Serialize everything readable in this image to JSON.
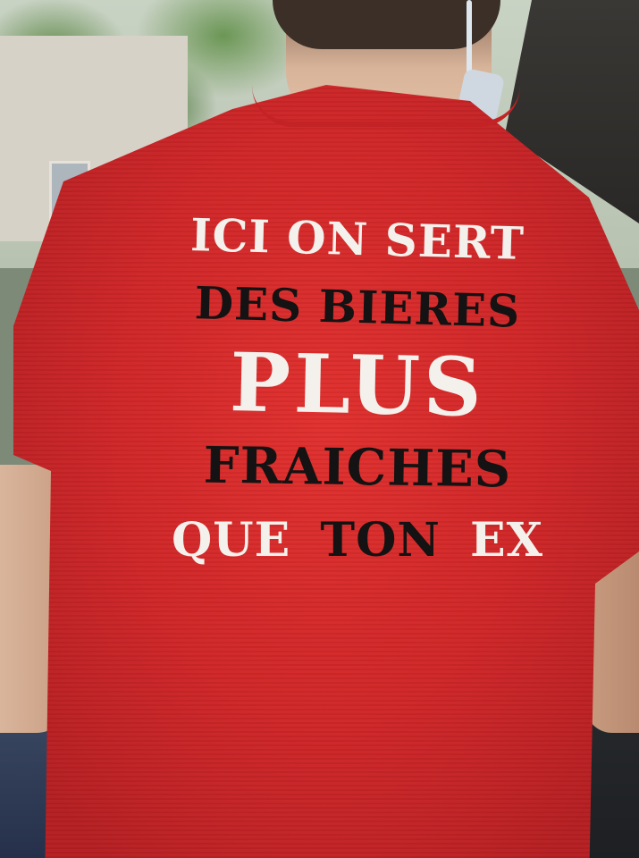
{
  "photo": {
    "subject": "t-shirt-back-print",
    "shirt_color": "#d42a2b",
    "print_colors": {
      "white": "#f4f1ec",
      "black": "#141212"
    }
  },
  "shirt_print": {
    "line1": "ICI ON SERT",
    "line2": "DES BIERES",
    "line3": "PLUS",
    "line4": "FRAICHES",
    "line5a": "QUE",
    "line5b": "TON",
    "line5c": "EX"
  }
}
